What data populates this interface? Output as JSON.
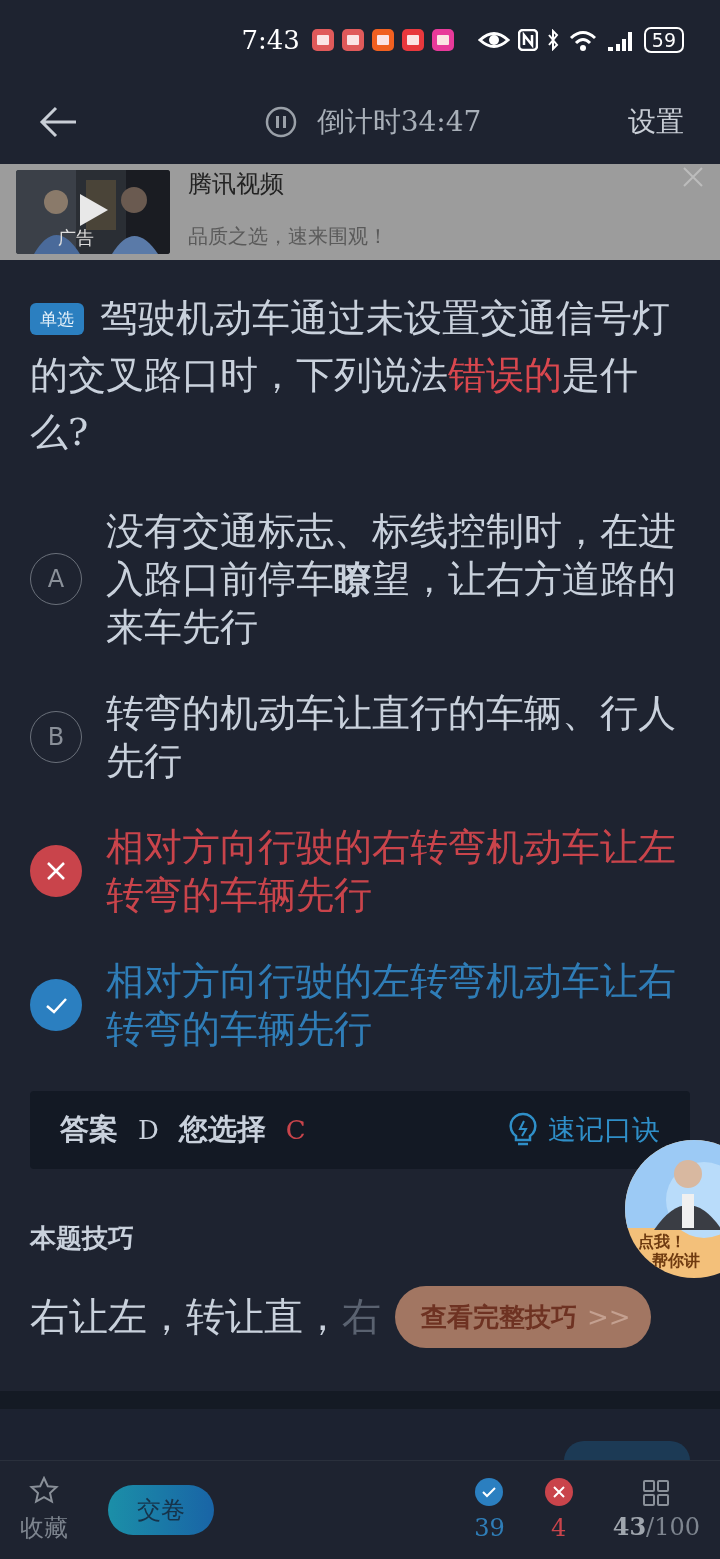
{
  "status_bar": {
    "time": "7:43",
    "battery": "59"
  },
  "header": {
    "countdown": "倒计时34:47",
    "settings": "设置"
  },
  "ad": {
    "badge": "广告",
    "title": "腾讯视频",
    "subtitle": "品质之选，速来围观！"
  },
  "question": {
    "tag": "单选",
    "parts": [
      {
        "text": "驾驶机动车通过未设置交通信号灯的交叉路口时，下列说法",
        "highlight": false
      },
      {
        "text": "错误的",
        "highlight": true
      },
      {
        "text": "是什么?",
        "highlight": false
      }
    ]
  },
  "options": [
    {
      "kind": "letter",
      "letter": "A",
      "text": "没有交通标志、标线控制时，在进入路口前停车**瞭**望，让右方道路的来车先行"
    },
    {
      "kind": "letter",
      "letter": "B",
      "text": "转弯的机动车让直行的车辆、行人先行"
    },
    {
      "kind": "wrong",
      "text": "相对方向行驶的右转弯机动车让左转弯的车辆先行"
    },
    {
      "kind": "correct",
      "text": "相对方向行驶的左转弯机动车让右转弯的车辆先行"
    }
  ],
  "answer": {
    "label": "答案",
    "correct": "D",
    "chosen_label": "您选择",
    "chosen": "C",
    "mnemonic": "速记口诀"
  },
  "tip": {
    "title": "本题技巧",
    "text": "右让左，转让直，",
    "faded": "右",
    "button": "查看完整技巧",
    "button_icon": ">>"
  },
  "float_badge": {
    "line1": "点我！",
    "line2": "帮你讲"
  },
  "bottom_bar": {
    "favorite": "收藏",
    "submit": "交卷",
    "right_count": "39",
    "wrong_count": "4",
    "progress": "**43**/100"
  }
}
